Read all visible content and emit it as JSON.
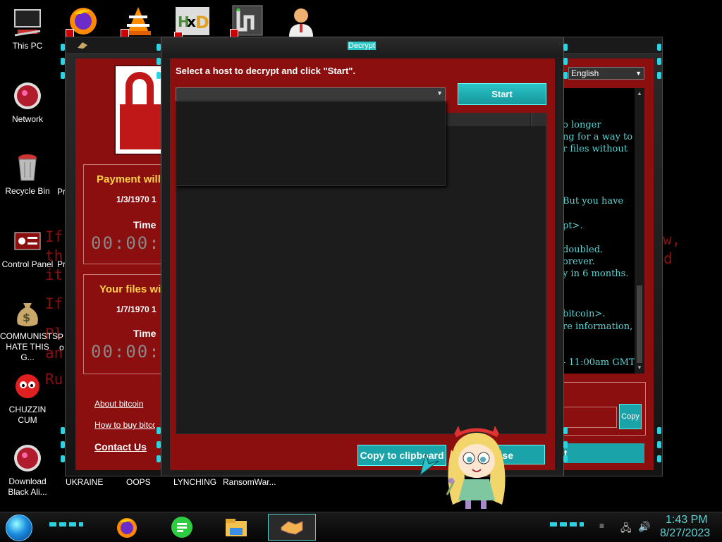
{
  "desktop": {
    "icons_left": [
      {
        "label": "This PC",
        "icon": "computer-icon"
      },
      {
        "label": "Network",
        "icon": "network-icon"
      },
      {
        "label": "Recycle Bin",
        "icon": "recycle-bin-icon"
      },
      {
        "label": "Control Panel",
        "icon": "control-panel-icon"
      },
      {
        "label": "COMMUNISTS HATE THIS G...",
        "icon": "money-bag-icon"
      },
      {
        "label": "CHUZZIN CUM",
        "icon": "chuzzle-icon"
      },
      {
        "label": "Download Black Ali...",
        "icon": "download-icon"
      }
    ],
    "icons_bottom": [
      {
        "label": "UKRAINE"
      },
      {
        "label": "OOPS"
      },
      {
        "label": "LYNCHING"
      },
      {
        "label": "RansomWar..."
      }
    ],
    "partial_labels": [
      "Pr",
      "Pr",
      "P",
      "o"
    ],
    "bg_lines_left": [
      "If",
      "th",
      "it",
      "If",
      "Pl",
      "an",
      "Ru"
    ],
    "bg_lines_right": [
      "w,",
      "d"
    ]
  },
  "wannacry": {
    "payment_title": "Payment will",
    "payment_date": "1/3/1970 1",
    "time_label": "Time",
    "timer1": "00:00:",
    "files_title": "Your files wi",
    "files_date": "1/7/1970 1",
    "time_label2": "Time",
    "timer2": "00:00:",
    "link_about": "About bitcoin",
    "link_buy": "How to buy bitcoin",
    "contact": "Contact Us",
    "language": "English",
    "message_lines": [
      "o longer",
      "ng for a way to",
      "r files without",
      "But you have",
      "pt>.",
      "doubled.",
      "orever.",
      "y in 6 months.",
      "bitcoin>.",
      "re information,",
      "- 11:00am GMT"
    ],
    "copy_small": "Copy",
    "check_btn": "t"
  },
  "decrypt": {
    "title": "Decrypt",
    "instruction": "Select a host to decrypt and click \"Start\".",
    "start": "Start",
    "copy_clipboard": "Copy to clipboard",
    "close_partial": "se"
  },
  "taskbar": {
    "time": "1:43 PM",
    "date": "8/27/2023"
  },
  "colors": {
    "accent": "#1aa3a8",
    "window_red": "#8b0f0f",
    "timer_gray": "#888888",
    "highlight_yellow": "#ffd24a"
  }
}
